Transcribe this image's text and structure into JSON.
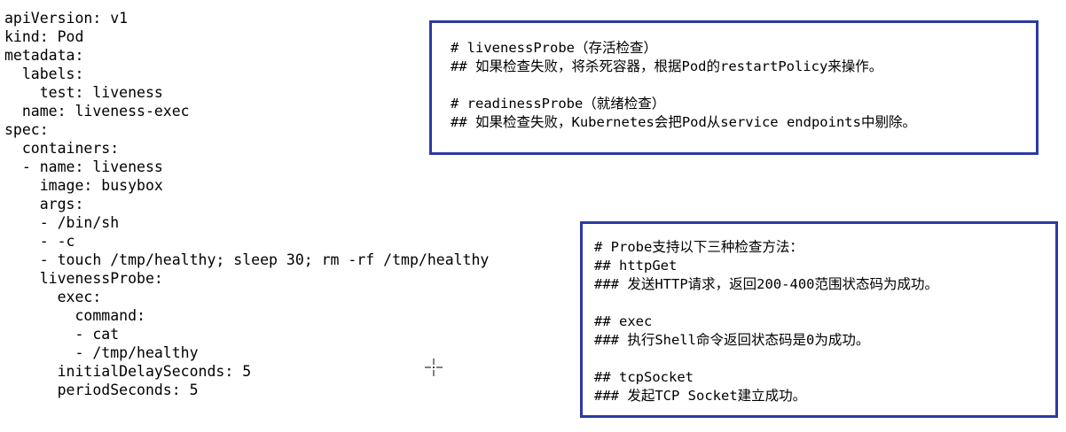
{
  "yaml_lines": [
    "apiVersion: v1",
    "kind: Pod",
    "metadata:",
    "  labels:",
    "    test: liveness",
    "  name: liveness-exec",
    "spec:",
    "  containers:",
    "  - name: liveness",
    "    image: busybox",
    "    args:",
    "    - /bin/sh",
    "    - -c",
    "    - touch /tmp/healthy; sleep 30; rm -rf /tmp/healthy",
    "    livenessProbe:",
    "      exec:",
    "        command:",
    "        - cat",
    "        - /tmp/healthy",
    "      initialDelaySeconds: 5",
    "      periodSeconds: 5"
  ],
  "probe_notes": [
    "# livenessProbe（存活检查）",
    "## 如果检查失败，将杀死容器，根据Pod的restartPolicy来操作。",
    "",
    "# readinessProbe（就绪检查）",
    "## 如果检查失败，Kubernetes会把Pod从service endpoints中剔除。"
  ],
  "probe_methods": [
    "# Probe支持以下三种检查方法：",
    "## httpGet",
    "### 发送HTTP请求，返回200-400范围状态码为成功。",
    "",
    "## exec",
    "### 执行Shell命令返回状态码是0为成功。",
    "",
    "## tcpSocket",
    "### 发起TCP Socket建立成功。"
  ],
  "colors": {
    "box_border": "#2b3aa3",
    "text": "#000000"
  },
  "icons": {
    "cursor": "crosshair-cursor-icon"
  }
}
